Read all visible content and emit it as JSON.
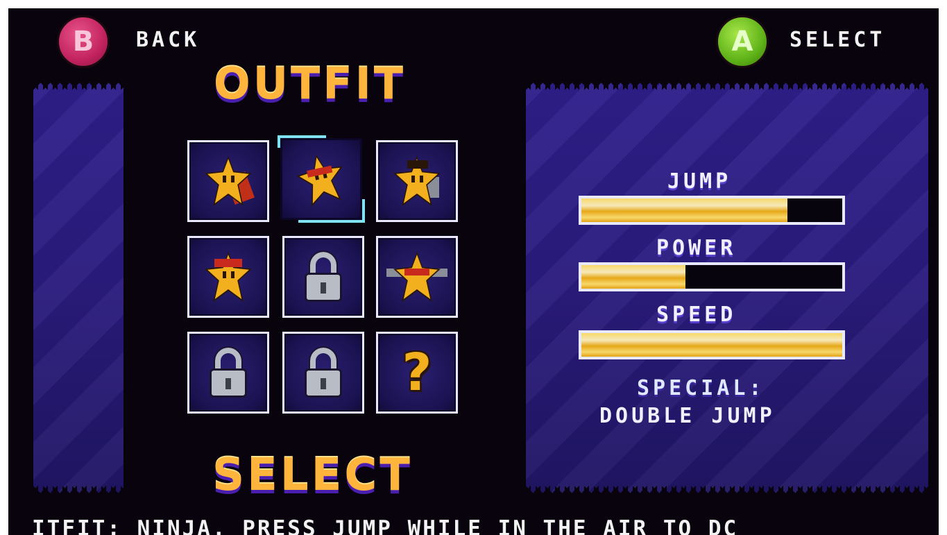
{
  "header": {
    "back_button_glyph": "B",
    "back_label": "BACK",
    "select_button_glyph": "A",
    "select_label": "SELECT"
  },
  "title_top": "OUTFIT",
  "title_bottom": "SELECT",
  "outfit_grid": {
    "rows": 3,
    "columns": 3,
    "selected_index": 1,
    "cells": [
      {
        "kind": "character",
        "icon": "caped-star-icon"
      },
      {
        "kind": "character",
        "icon": "ninja-star-icon"
      },
      {
        "kind": "character",
        "icon": "jetpack-star-icon"
      },
      {
        "kind": "character",
        "icon": "bandana-star-icon"
      },
      {
        "kind": "locked",
        "icon": "lock-icon"
      },
      {
        "kind": "character",
        "icon": "masked-star-icon"
      },
      {
        "kind": "locked",
        "icon": "lock-icon"
      },
      {
        "kind": "locked",
        "icon": "lock-icon"
      },
      {
        "kind": "mystery",
        "icon": "question-mark-icon",
        "glyph": "?"
      }
    ]
  },
  "stats": {
    "jump": {
      "label": "JUMP",
      "level": 0.79
    },
    "power": {
      "label": "POWER",
      "level": 0.4
    },
    "speed": {
      "label": "SPEED",
      "level": 1.0
    },
    "special_label": "SPECIAL:",
    "special_value": "DOUBLE JUMP"
  },
  "ticker_text": "ITFIT: NINJA.  PRESS JUMP WHILE IN THE AIR TO DC",
  "colors": {
    "panel_purple": "#2a1b7d",
    "bar_gold": "#f2b01e",
    "title_orange": "#ffb43c",
    "cursor_cyan": "#7fe3f5",
    "b_button": "#c2235e",
    "a_button": "#5fb318"
  }
}
